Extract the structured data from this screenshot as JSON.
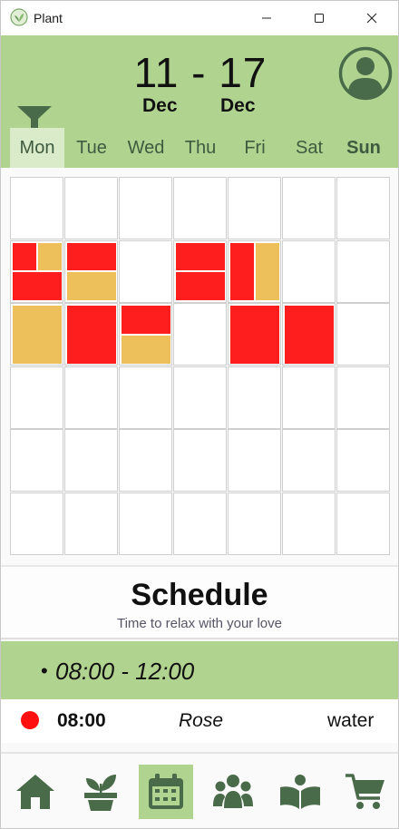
{
  "window": {
    "title": "Plant"
  },
  "header": {
    "date_range": "11 - 17",
    "month_start": "Dec",
    "month_end": "Dec"
  },
  "days": [
    "Mon",
    "Tue",
    "Wed",
    "Thu",
    "Fri",
    "Sat",
    "Sun"
  ],
  "selected_day": "Mon",
  "schedule": {
    "title": "Schedule",
    "subtitle": "Time to relax with your love",
    "time_slot": "08:00 - 12:00",
    "bullet": "•",
    "events": [
      {
        "time": "08:00",
        "plant": "Rose",
        "action": "water",
        "status_color": "#ff1010"
      }
    ]
  },
  "colors": {
    "accent": "#b0d490",
    "icon": "#4a6b4a",
    "task_red": "#ff1e1e",
    "task_amber": "#eec05c"
  },
  "nav": [
    {
      "icon": "home-icon",
      "label": "Home"
    },
    {
      "icon": "plant-icon",
      "label": "Plants"
    },
    {
      "icon": "calendar-icon",
      "label": "Calendar"
    },
    {
      "icon": "community-icon",
      "label": "Community"
    },
    {
      "icon": "guide-icon",
      "label": "Guide"
    },
    {
      "icon": "cart-icon",
      "label": "Shop"
    }
  ]
}
